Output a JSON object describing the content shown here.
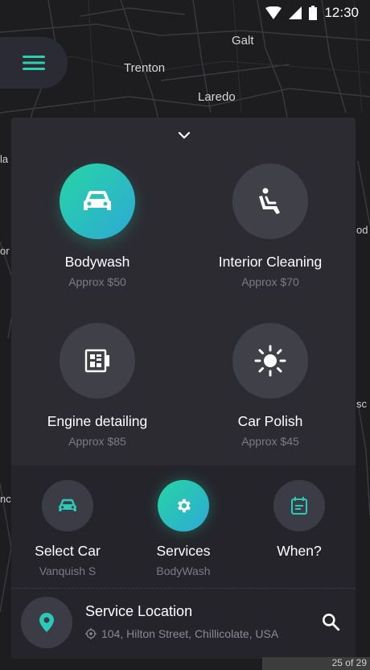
{
  "status_bar": {
    "time": "12:30"
  },
  "map": {
    "labels": {
      "galt": "Galt",
      "trenton": "Trenton",
      "laredo": "Laredo",
      "edge_la": "la",
      "edge_sc": "sc",
      "edge_od": "od",
      "edge_or": "or",
      "edge_nc": "nc"
    }
  },
  "menu": {
    "icon": "hamburger-menu-icon"
  },
  "services": [
    {
      "name": "Bodywash",
      "price": "Approx $50",
      "icon": "car-icon",
      "selected": true
    },
    {
      "name": "Interior Cleaning",
      "price": "Approx $70",
      "icon": "car-seat-icon",
      "selected": false
    },
    {
      "name": "Engine detailing",
      "price": "Approx $85",
      "icon": "engine-icon",
      "selected": false
    },
    {
      "name": "Car Polish",
      "price": "Approx $45",
      "icon": "sun-icon",
      "selected": false
    }
  ],
  "steps": [
    {
      "title": "Select Car",
      "sub": "Vanquish S",
      "icon": "car-icon"
    },
    {
      "title": "Services",
      "sub": "BodyWash",
      "icon": "gear-icon",
      "active": true
    },
    {
      "title": "When?",
      "sub": "",
      "icon": "calendar-icon"
    }
  ],
  "location": {
    "title": "Service Location",
    "address": "104, Hilton Street, Chillicolate, USA"
  },
  "page_indicator": "25 of 29",
  "colors": {
    "accent_start": "#26d5a4",
    "accent_end": "#2ea9d6",
    "panel": "#2c2b32"
  }
}
